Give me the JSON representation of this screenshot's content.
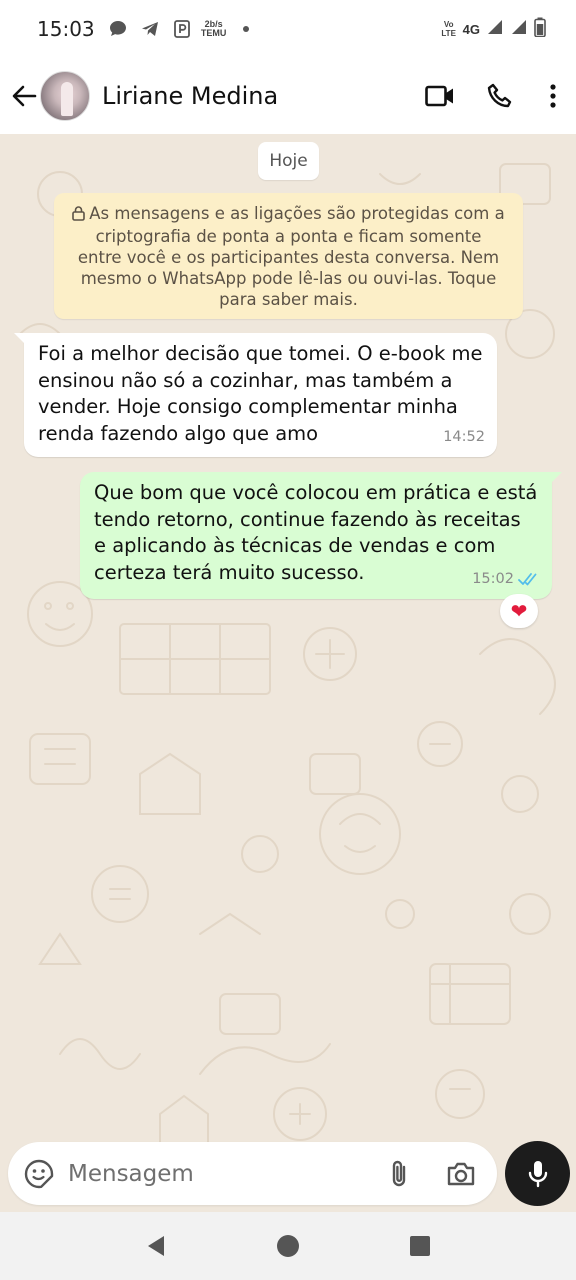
{
  "status_bar": {
    "time": "15:03",
    "network": "4G",
    "volte": "Vo LTE",
    "temu_top": "2b/s",
    "temu_bottom": "TEMU"
  },
  "header": {
    "contact_name": "Liriane Medina"
  },
  "chat": {
    "date_chip": "Hoje",
    "encryption_notice": "As mensagens e as ligações são protegidas com a criptografia de ponta a ponta e ficam somente entre você e os participantes desta conversa. Nem mesmo o WhatsApp pode lê-las ou ouvi-las. Toque para saber mais.",
    "messages": [
      {
        "direction": "incoming",
        "text": "Foi a melhor decisão que tomei. O e-book me ensinou não só a cozinhar, mas também a vender. Hoje consigo complementar minha renda fazendo algo que amo",
        "time": "14:52"
      },
      {
        "direction": "outgoing",
        "text": "Que bom que você colocou em prática e está tendo retorno, continue fazendo às receitas e aplicando às técnicas de vendas e com certeza terá muito sucesso.",
        "time": "15:02",
        "status": "read",
        "reaction": "❤"
      }
    ]
  },
  "composer": {
    "placeholder": "Mensagem"
  },
  "colors": {
    "incoming_bubble": "#ffffff",
    "outgoing_bubble": "#d9fdd3",
    "encryption_bg": "#fcefc8",
    "read_ticks": "#53bdeb",
    "chat_bg": "#efe7dc"
  }
}
